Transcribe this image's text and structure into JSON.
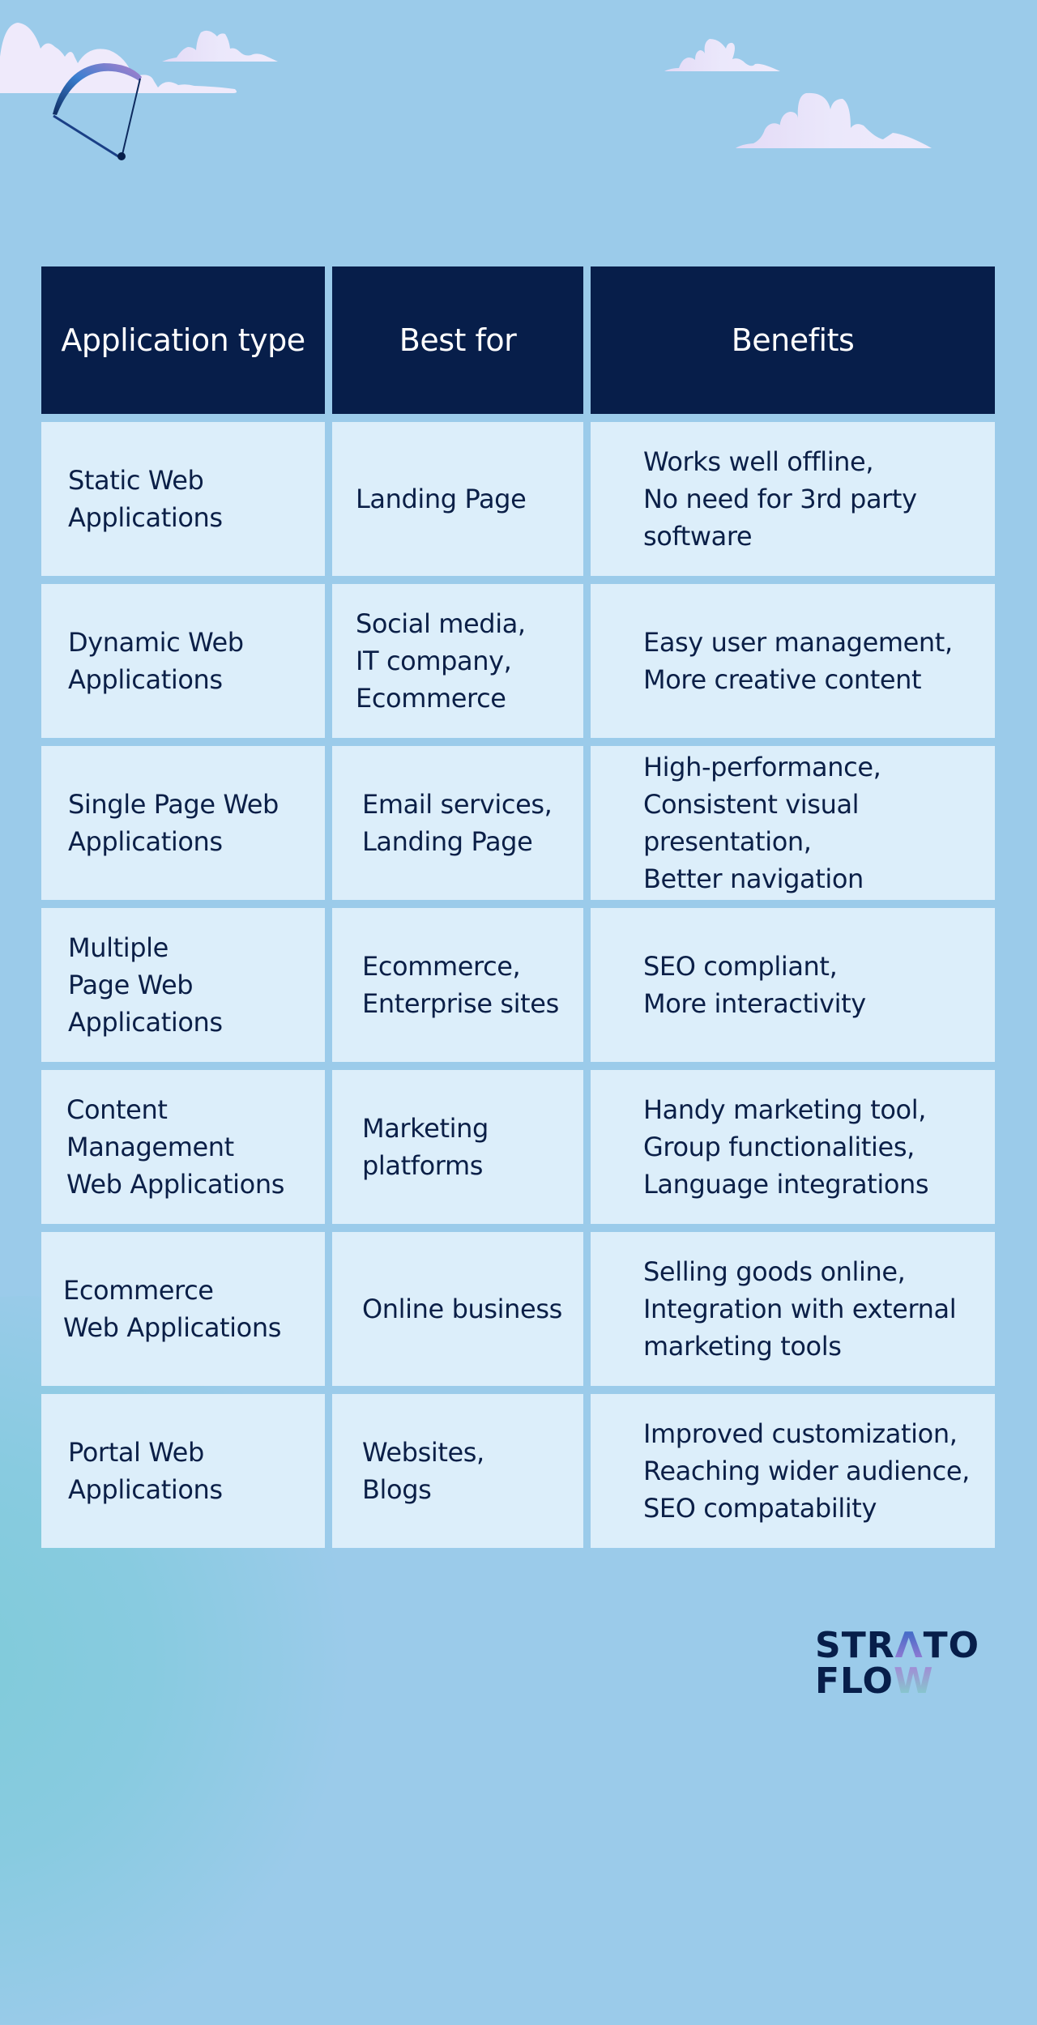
{
  "table": {
    "headers": [
      "Application type",
      "Best for",
      "Benefits"
    ],
    "rows": [
      {
        "type": "Static Web\nApplications",
        "best_for": "Landing Page",
        "benefits": "Works well offline,\nNo need for 3rd party\nsoftware"
      },
      {
        "type": "Dynamic Web\nApplications",
        "best_for": "Social media,\nIT company,\nEcommerce",
        "benefits": "Easy user management,\nMore creative content"
      },
      {
        "type": "Single Page Web\nApplications",
        "best_for": "Email services,\nLanding Page",
        "benefits": "High-performance,\nConsistent visual\npresentation,\nBetter navigation"
      },
      {
        "type": "Multiple\nPage Web\nApplications",
        "best_for": "Ecommerce,\nEnterprise sites",
        "benefits": "SEO compliant,\nMore interactivity"
      },
      {
        "type": "Content\nManagement\nWeb Applications",
        "best_for": "Marketing\nplatforms",
        "benefits": "Handy marketing tool,\nGroup functionalities,\nLanguage integrations"
      },
      {
        "type": "Ecommerce\nWeb Applications",
        "best_for": "Online business",
        "benefits": "Selling goods online,\nIntegration with external\nmarketing tools"
      },
      {
        "type": "Portal Web\nApplications",
        "best_for": "Websites,\nBlogs",
        "benefits": "Improved customization,\nReaching wider audience,\nSEO compatability"
      }
    ]
  },
  "logo": {
    "line1_pre": "STR",
    "line1_accent": "Λ",
    "line1_post": "TO",
    "line2_pre": "FLO",
    "line2_accent": "W"
  },
  "decorations": {
    "icons": [
      "cloud-icon",
      "paraglider-icon"
    ]
  },
  "colors": {
    "background": "#9bcbea",
    "header": "#071e4a",
    "cell": "#dceefa",
    "text": "#0b1f47"
  }
}
